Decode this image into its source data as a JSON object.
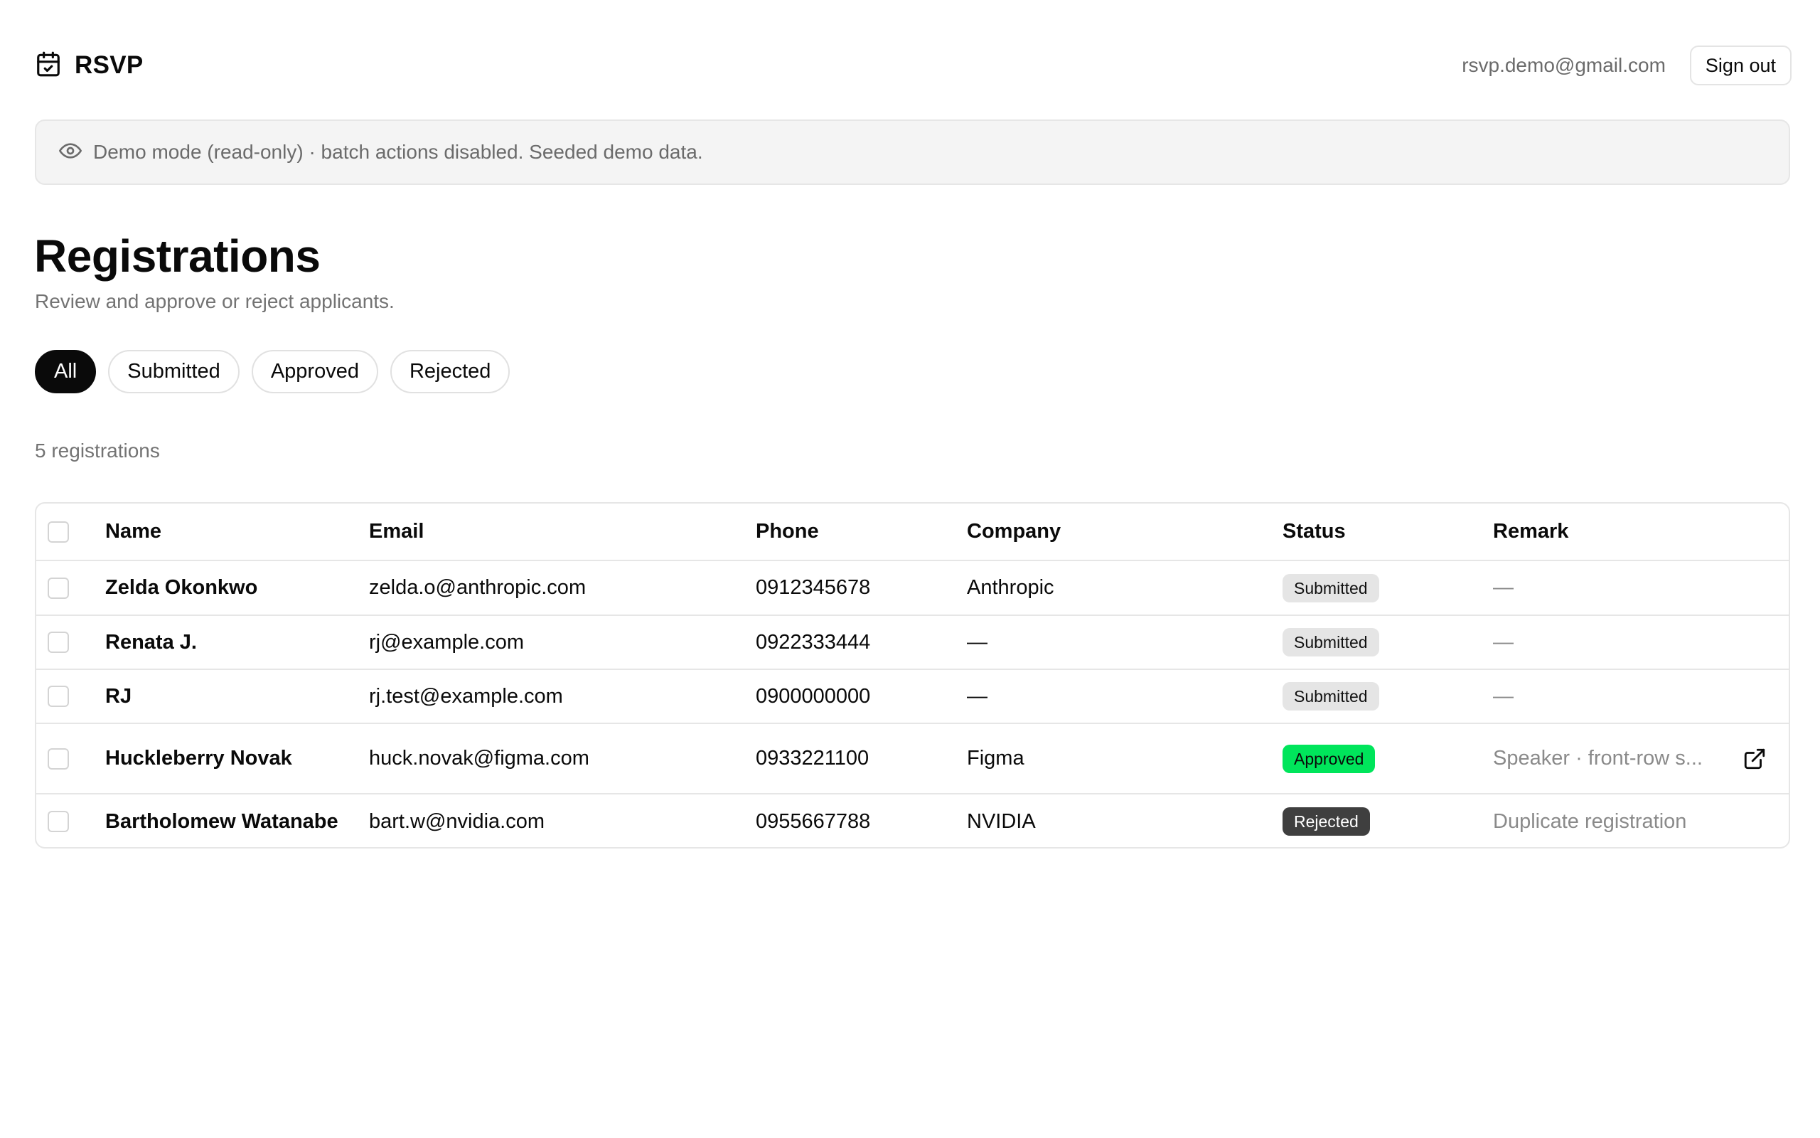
{
  "app": {
    "name": "RSVP"
  },
  "header": {
    "user_email": "rsvp.demo@gmail.com",
    "signout_label": "Sign out"
  },
  "banner": {
    "text": "Demo mode (read-only) · batch actions disabled. Seeded demo data."
  },
  "page": {
    "title": "Registrations",
    "subtitle": "Review and approve or reject applicants."
  },
  "filters": {
    "items": [
      "All",
      "Submitted",
      "Approved",
      "Rejected"
    ],
    "active": "All"
  },
  "count_label": "5 registrations",
  "table": {
    "columns": [
      "Name",
      "Email",
      "Phone",
      "Company",
      "Status",
      "Remark"
    ],
    "rows": [
      {
        "name": "Zelda Okonkwo",
        "email": "zelda.o@anthropic.com",
        "phone": "0912345678",
        "company": "Anthropic",
        "status": "Submitted",
        "remark": "—"
      },
      {
        "name": "Renata J.",
        "email": "rj@example.com",
        "phone": "0922333444",
        "company": "—",
        "status": "Submitted",
        "remark": "—"
      },
      {
        "name": "RJ",
        "email": "rj.test@example.com",
        "phone": "0900000000",
        "company": "—",
        "status": "Submitted",
        "remark": "—"
      },
      {
        "name": "Huckleberry Novak",
        "email": "huck.novak@figma.com",
        "phone": "0933221100",
        "company": "Figma",
        "status": "Approved",
        "remark": "Speaker · front-row s..."
      },
      {
        "name": "Bartholomew Watanabe",
        "email": "bart.w@nvidia.com",
        "phone": "0955667788",
        "company": "NVIDIA",
        "status": "Rejected",
        "remark": "Duplicate registration"
      }
    ]
  },
  "icons": {
    "brand": "calendar-check-icon",
    "banner": "eye-icon",
    "remark_link": "external-link-icon"
  },
  "colors": {
    "approved": "#00e55b",
    "rejected": "#3f3f3f",
    "submitted": "#e5e5e5",
    "active_chip": "#0a0a0a"
  }
}
